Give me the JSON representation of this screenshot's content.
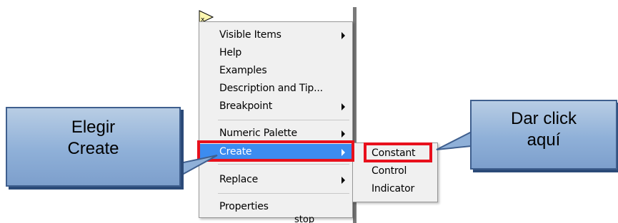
{
  "context_menu": {
    "items": [
      {
        "label": "Visible Items",
        "submenu": true
      },
      {
        "label": "Help",
        "submenu": false
      },
      {
        "label": "Examples",
        "submenu": false
      },
      {
        "label": "Description and Tip...",
        "submenu": false
      },
      {
        "label": "Breakpoint",
        "submenu": true
      },
      {
        "label": "Numeric Palette",
        "submenu": true
      },
      {
        "label": "Create",
        "submenu": true,
        "highlighted": true
      },
      {
        "label": "Replace",
        "submenu": true
      },
      {
        "label": "Properties",
        "submenu": false
      }
    ]
  },
  "create_submenu": {
    "items": [
      {
        "label": "Constant"
      },
      {
        "label": "Control"
      },
      {
        "label": "Indicator"
      }
    ]
  },
  "callouts": {
    "left": "Elegir Create",
    "right": "Dar click aquí"
  },
  "diagram_label": "stop",
  "colors": {
    "highlight_border": "#e8101c",
    "active_item": "#3c8cf0",
    "callout_fill": "#8fb0d8"
  }
}
